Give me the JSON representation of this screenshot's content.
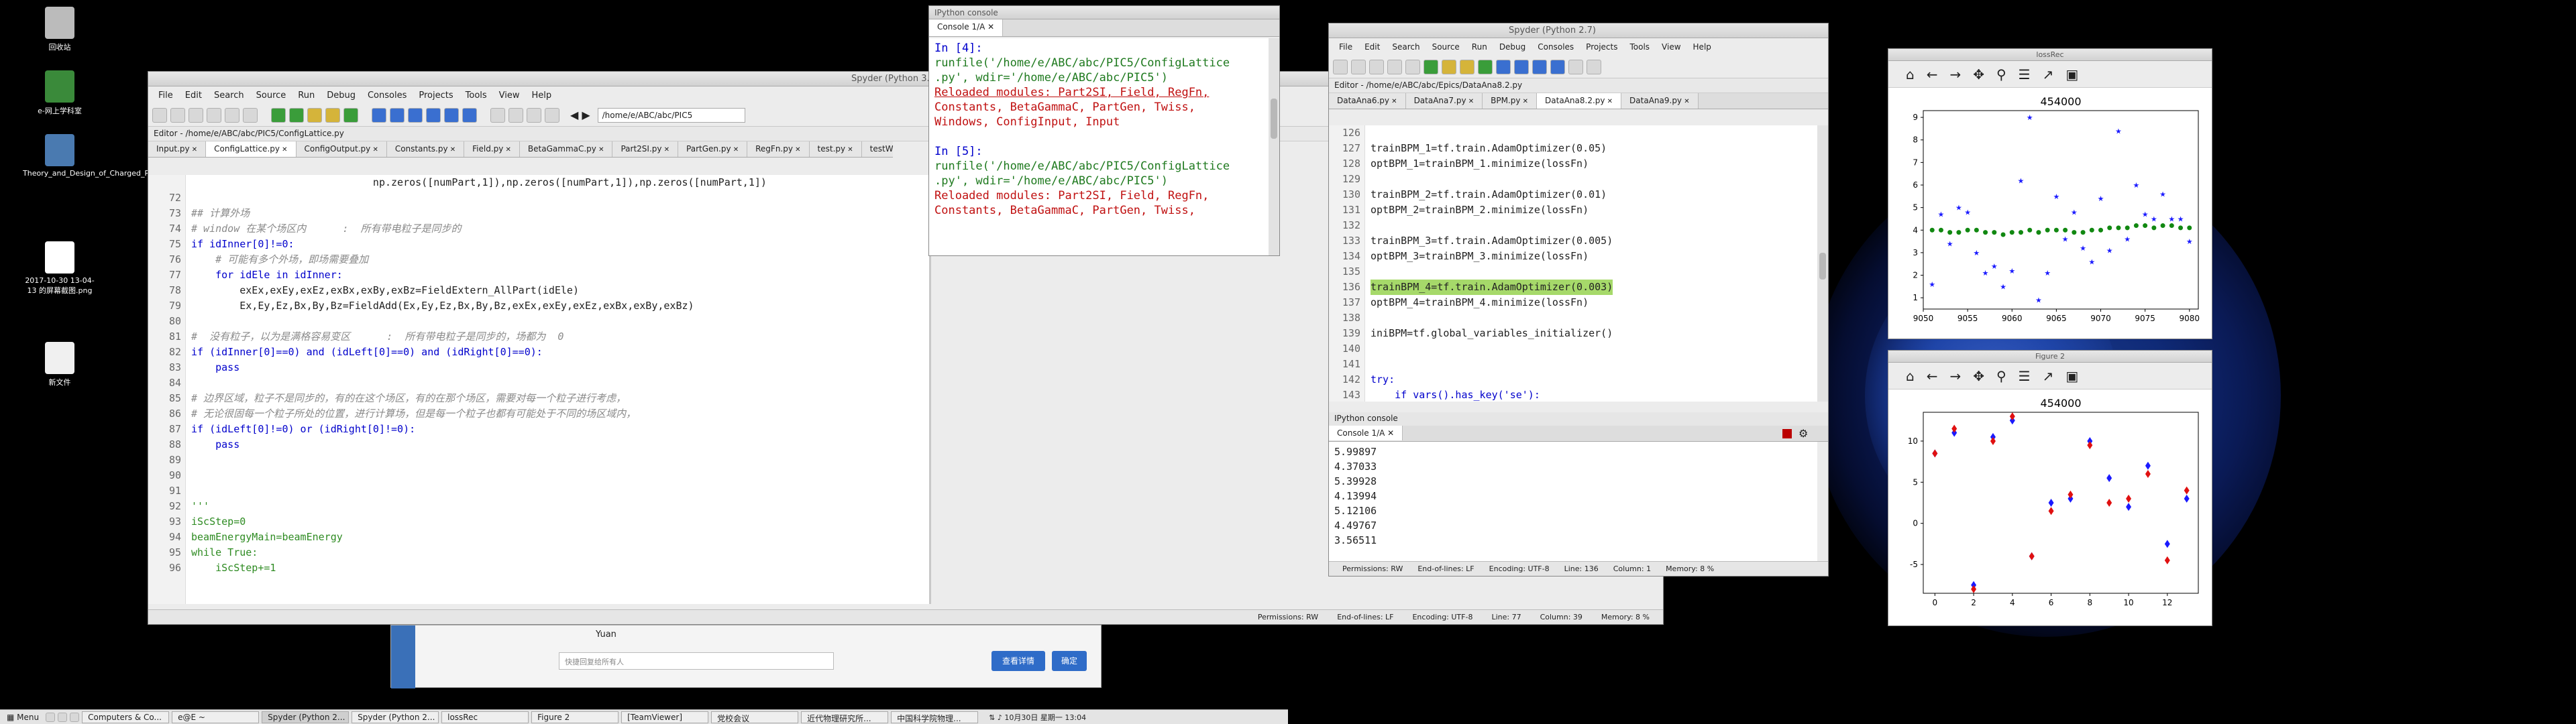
{
  "desktop": {
    "icons": [
      {
        "label": "回收站",
        "color": "#bbbbbb"
      },
      {
        "label": "e-网上学科室",
        "color": "#3a8a3a"
      },
      {
        "label": "Theory_and_Design_of_Charged_Particle_[Reiser_M.]_(BookFi...",
        "color": "#4a7ab0"
      },
      {
        "label": "2017-10-30 13-04-13 的屏幕截图.png",
        "color": "#ffffff"
      },
      {
        "label": "新文件",
        "color": "#f0f0f0"
      }
    ]
  },
  "spyder_left": {
    "title": "Spyder (Python 3.",
    "menu": [
      "File",
      "Edit",
      "Search",
      "Source",
      "Run",
      "Debug",
      "Consoles",
      "Projects",
      "Tools",
      "View",
      "Help"
    ],
    "path": "/home/e/ABC/abc/PIC5",
    "editor_label": "Editor - /home/e/ABC/abc/PIC5/ConfigLattice.py",
    "tabs": [
      "Input.py",
      "ConfigLattice.py",
      "ConfigOutput.py",
      "Constants.py",
      "Field.py",
      "BetaGammaC.py",
      "Part2SI.py",
      "PartGen.py",
      "RegFn.py",
      "test.py",
      "testWindow"
    ],
    "lines": [
      {
        "n": "",
        "t": "                              np.zeros([numPart,1]),np.zeros([numPart,1]),np.zeros([numPart,1])",
        "c": ""
      },
      {
        "n": "72",
        "t": "",
        "c": ""
      },
      {
        "n": "73",
        "t": "## 计算外场",
        "c": "cm"
      },
      {
        "n": "74",
        "t": "# window 在某个场区内      :  所有带电粒子是同步的",
        "c": "cm"
      },
      {
        "n": "75",
        "t": "if idInner[0]!=0:",
        "c": "kw"
      },
      {
        "n": "76",
        "t": "    # 可能有多个外场，即场需要叠加",
        "c": "cm"
      },
      {
        "n": "77",
        "t": "    for idEle in idInner:",
        "c": "kw"
      },
      {
        "n": "78",
        "t": "        exEx,exEy,exEz,exBx,exBy,exBz=FieldExtern_AllPart(idEle)",
        "c": ""
      },
      {
        "n": "79",
        "t": "        Ex,Ey,Ez,Bx,By,Bz=FieldAdd(Ex,Ey,Ez,Bx,By,Bz,exEx,exEy,exEz,exBx,exBy,exBz)",
        "c": ""
      },
      {
        "n": "80",
        "t": "",
        "c": ""
      },
      {
        "n": "81",
        "t": "#  没有粒子，以为是满格容易变区      :  所有带电粒子是同步的，场都为  0",
        "c": "cm"
      },
      {
        "n": "82",
        "t": "if (idInner[0]==0) and (idLeft[0]==0) and (idRight[0]==0):",
        "c": "kw"
      },
      {
        "n": "83",
        "t": "    pass",
        "c": "kw"
      },
      {
        "n": "84",
        "t": "",
        "c": ""
      },
      {
        "n": "85",
        "t": "# 边界区域，粒子不是同步的，有的在这个场区，有的在那个场区，需要对每一个粒子进行考虑，",
        "c": "cm"
      },
      {
        "n": "86",
        "t": "# 无论很固每一个粒子所处的位置，进行计算场，但是每一个粒子也都有可能处于不同的场区域内，",
        "c": "cm"
      },
      {
        "n": "87",
        "t": "if (idLeft[0]!=0) or (idRight[0]!=0):",
        "c": "kw"
      },
      {
        "n": "88",
        "t": "    pass",
        "c": "kw"
      },
      {
        "n": "89",
        "t": "",
        "c": ""
      },
      {
        "n": "90",
        "t": "",
        "c": ""
      },
      {
        "n": "91",
        "t": "",
        "c": ""
      },
      {
        "n": "92",
        "t": "'''",
        "c": "str"
      },
      {
        "n": "93",
        "t": "iScStep=0",
        "c": "str"
      },
      {
        "n": "94",
        "t": "beamEnergyMain=beamEnergy",
        "c": "str"
      },
      {
        "n": "95",
        "t": "while True:",
        "c": "str"
      },
      {
        "n": "96",
        "t": "    iScStep+=1",
        "c": "str"
      }
    ],
    "status": {
      "permissions": "Permissions: RW",
      "eol": "End-of-lines: LF",
      "encoding": "Encoding: UTF-8",
      "line": "Line: 77",
      "column": "Column: 39",
      "memory": "Memory: 8 %"
    }
  },
  "ipython_left": {
    "title": "IPython console",
    "tab": "Console 1/A",
    "lines": [
      {
        "t": "In [4]:",
        "c": "kw"
      },
      {
        "t": "runfile('/home/e/ABC/abc/PIC5/ConfigLattice",
        "c": "mix"
      },
      {
        "t": ".py', wdir='/home/e/ABC/abc/PIC5')",
        "c": "mix"
      },
      {
        "t": "Reloaded modules: Part2SI, Field, RegFn,",
        "c": "red"
      },
      {
        "t": "Constants, BetaGammaC, PartGen, Twiss,",
        "c": "red"
      },
      {
        "t": "Windows, ConfigInput, Input",
        "c": "red"
      },
      {
        "t": "",
        "c": ""
      },
      {
        "t": "In [5]:",
        "c": "kw"
      },
      {
        "t": "runfile('/home/e/ABC/abc/PIC5/ConfigLattice",
        "c": "mix"
      },
      {
        "t": ".py', wdir='/home/e/ABC/abc/PIC5')",
        "c": "mix"
      },
      {
        "t": "Reloaded modules: Part2SI, Field, RegFn,",
        "c": "red"
      },
      {
        "t": "Constants, BetaGammaC, PartGen, Twiss,",
        "c": "red"
      }
    ]
  },
  "chat_popup": {
    "name": "Yuan",
    "placeholder": "快捷回复给所有人",
    "btn1": "查看详情",
    "btn2": "确定"
  },
  "spyder_right": {
    "title": "Spyder (Python 2.7)",
    "menu": [
      "File",
      "Edit",
      "Search",
      "Source",
      "Run",
      "Debug",
      "Consoles",
      "Projects",
      "Tools",
      "View",
      "Help"
    ],
    "editor_label": "Editor - /home/e/ABC/abc/Epics/DataAna8.2.py",
    "tabs": [
      "DataAna6.py",
      "DataAna7.py",
      "BPM.py",
      "DataAna8.2.py",
      "DataAna9.py"
    ],
    "lines": [
      {
        "n": "126",
        "t": "",
        "c": ""
      },
      {
        "n": "127",
        "t": "trainBPM_1=tf.train.AdamOptimizer(0.05)",
        "c": ""
      },
      {
        "n": "128",
        "t": "optBPM_1=trainBPM_1.minimize(lossFn)",
        "c": ""
      },
      {
        "n": "129",
        "t": "",
        "c": ""
      },
      {
        "n": "130",
        "t": "trainBPM_2=tf.train.AdamOptimizer(0.01)",
        "c": ""
      },
      {
        "n": "131",
        "t": "optBPM_2=trainBPM_2.minimize(lossFn)",
        "c": ""
      },
      {
        "n": "132",
        "t": "",
        "c": ""
      },
      {
        "n": "133",
        "t": "trainBPM_3=tf.train.AdamOptimizer(0.005)",
        "c": ""
      },
      {
        "n": "134",
        "t": "optBPM_3=trainBPM_3.minimize(lossFn)",
        "c": ""
      },
      {
        "n": "135",
        "t": "",
        "c": ""
      },
      {
        "n": "136",
        "t": "trainBPM_4=tf.train.AdamOptimizer(0.003)",
        "c": "hl"
      },
      {
        "n": "137",
        "t": "optBPM_4=trainBPM_4.minimize(lossFn)",
        "c": ""
      },
      {
        "n": "138",
        "t": "",
        "c": ""
      },
      {
        "n": "139",
        "t": "iniBPM=tf.global_variables_initializer()",
        "c": ""
      },
      {
        "n": "140",
        "t": "",
        "c": ""
      },
      {
        "n": "141",
        "t": "",
        "c": ""
      },
      {
        "n": "142",
        "t": "try:",
        "c": "kw"
      },
      {
        "n": "143",
        "t": "    if vars().has_key('se'):",
        "c": "kw"
      }
    ],
    "console_title": "IPython console",
    "console_tab": "Console 1/A",
    "console_lines": [
      "5.99897",
      "4.37033",
      "5.39928",
      "4.13994",
      "5.12106",
      "4.49767",
      "3.56511"
    ],
    "status": {
      "permissions": "Permissions: RW",
      "eol": "End-of-lines: LF",
      "encoding": "Encoding: UTF-8",
      "line": "Line: 136",
      "column": "Column: 1",
      "memory": "Memory: 8 %"
    }
  },
  "fig_top": {
    "title": "lossRec",
    "chart_title": "454000"
  },
  "fig_bottom": {
    "title": "Figure 2",
    "chart_title": "454000"
  },
  "taskbar": {
    "menu": "Menu",
    "tasks": [
      "Computers & Co...",
      "e@E ~",
      "Spyder (Python 2...",
      "Spyder (Python 2...",
      "lossRec",
      "Figure 2",
      "[TeamViewer]",
      "党校会议",
      "近代物理研究所...",
      "中国科学院物理..."
    ],
    "active": 2,
    "clock": "10月30日 星期一 13:04"
  },
  "chart_data": [
    {
      "type": "scatter",
      "title": "454000",
      "xlim": [
        9050,
        9081
      ],
      "ylim": [
        0.5,
        9.3
      ],
      "xticks": [
        9050,
        9055,
        9060,
        9065,
        9070,
        9075,
        9080
      ],
      "yticks": [
        1,
        2,
        3,
        4,
        5,
        6,
        7,
        8,
        9
      ],
      "series": [
        {
          "color": "#1a1aff",
          "marker": "star",
          "x": [
            9051,
            9052,
            9053,
            9054,
            9055,
            9056,
            9057,
            9058,
            9059,
            9060,
            9061,
            9062,
            9063,
            9064,
            9065,
            9066,
            9067,
            9068,
            9069,
            9070,
            9071,
            9072,
            9073,
            9074,
            9075,
            9076,
            9077,
            9078,
            9079,
            9080
          ],
          "y": [
            1.6,
            4.7,
            3.4,
            5.0,
            4.8,
            3.0,
            2.1,
            2.4,
            1.5,
            2.2,
            6.2,
            9.0,
            0.9,
            2.1,
            5.5,
            3.6,
            4.8,
            3.2,
            2.6,
            5.4,
            3.1,
            8.4,
            3.6,
            6.0,
            4.7,
            4.5,
            5.6,
            4.5,
            4.5,
            3.5
          ]
        },
        {
          "color": "#118811",
          "marker": "dot",
          "x": [
            9051,
            9052,
            9053,
            9054,
            9055,
            9056,
            9057,
            9058,
            9059,
            9060,
            9061,
            9062,
            9063,
            9064,
            9065,
            9066,
            9067,
            9068,
            9069,
            9070,
            9071,
            9072,
            9073,
            9074,
            9075,
            9076,
            9077,
            9078,
            9079,
            9080
          ],
          "y": [
            4.0,
            4.0,
            3.9,
            3.9,
            4.0,
            4.0,
            3.9,
            3.9,
            3.8,
            3.9,
            3.9,
            4.0,
            3.9,
            4.0,
            4.0,
            4.0,
            3.9,
            3.9,
            4.0,
            4.0,
            4.1,
            4.1,
            4.1,
            4.2,
            4.2,
            4.1,
            4.2,
            4.2,
            4.1,
            4.1
          ]
        }
      ]
    },
    {
      "type": "scatter",
      "title": "454000",
      "xlim": [
        -0.6,
        13.6
      ],
      "ylim": [
        -8.5,
        13.5
      ],
      "xticks": [
        0,
        2,
        4,
        6,
        8,
        10,
        12
      ],
      "yticks": [
        -5,
        0,
        5,
        10
      ],
      "series": [
        {
          "color": "#1a1aff",
          "marker": "diamond",
          "x": [
            0,
            1,
            2,
            3,
            4,
            5,
            6,
            7,
            8,
            9,
            10,
            11,
            12,
            13
          ],
          "y": [
            8.5,
            11.0,
            -7.5,
            10.5,
            12.5,
            -4.0,
            2.5,
            3.0,
            10.0,
            5.5,
            2.0,
            7.0,
            -2.5,
            3.0
          ]
        },
        {
          "color": "#e01010",
          "marker": "diamond",
          "x": [
            0,
            1,
            2,
            3,
            4,
            5,
            6,
            7,
            8,
            9,
            10,
            11,
            12,
            13
          ],
          "y": [
            8.5,
            11.5,
            -8.0,
            10.0,
            13.0,
            -4.0,
            1.5,
            3.5,
            9.5,
            2.5,
            3.0,
            6.0,
            -4.5,
            4.0
          ]
        }
      ]
    }
  ]
}
